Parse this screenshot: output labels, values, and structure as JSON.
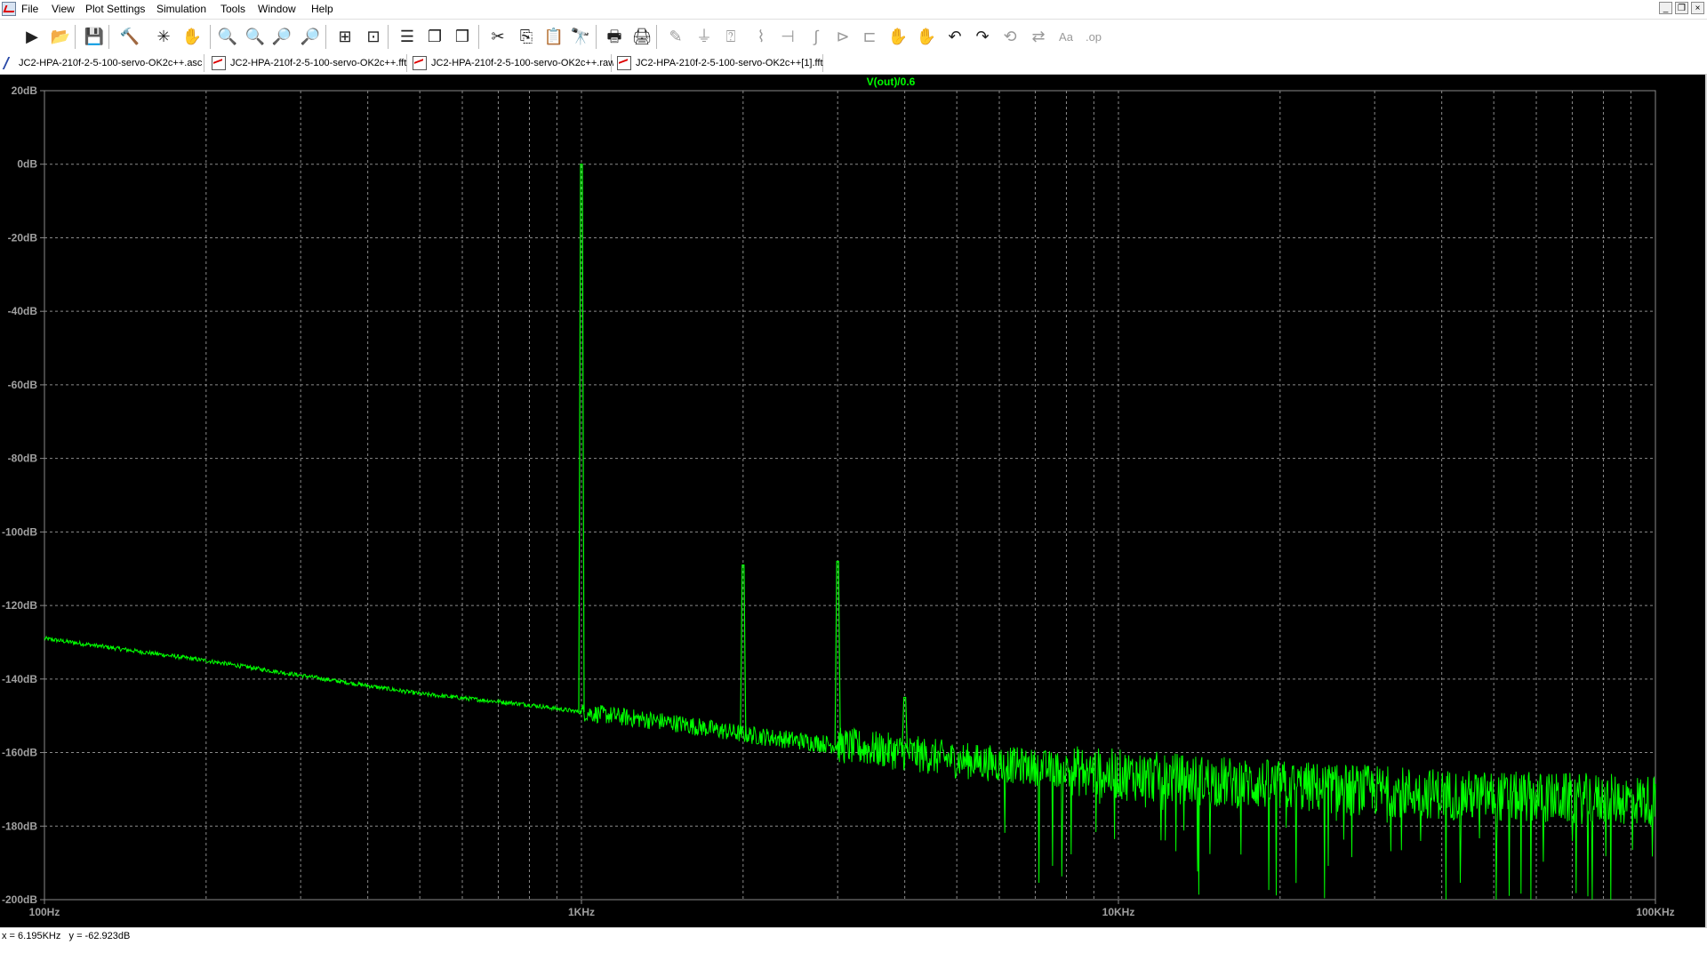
{
  "menu": [
    "File",
    "View",
    "Plot Settings",
    "Simulation",
    "Tools",
    "Window",
    "Help"
  ],
  "window_buttons": [
    "_",
    "❐",
    "×"
  ],
  "toolbar": [
    {
      "name": "run-icon",
      "glyph": "▶"
    },
    {
      "name": "open-folder-icon",
      "glyph": "📂"
    },
    {
      "name": "save-icon",
      "glyph": "💾"
    },
    {
      "name": "control-panel-icon",
      "glyph": "🔨"
    },
    {
      "name": "halt-icon",
      "glyph": "✳"
    },
    {
      "name": "pan-icon",
      "glyph": "✋"
    },
    {
      "name": "zoom-in-icon",
      "glyph": "🔍"
    },
    {
      "name": "zoom-area-icon",
      "glyph": "🔍"
    },
    {
      "name": "zoom-out-icon",
      "glyph": "🔎"
    },
    {
      "name": "zoom-fit-icon",
      "glyph": "🔎"
    },
    {
      "name": "autorange-icon",
      "glyph": "⊞"
    },
    {
      "name": "autoscale-icon",
      "glyph": "⊡"
    },
    {
      "name": "tile-horizontal-icon",
      "glyph": "☰"
    },
    {
      "name": "cascade-icon",
      "glyph": "❐"
    },
    {
      "name": "tile-vertical-icon",
      "glyph": "❒"
    },
    {
      "name": "cut-icon",
      "glyph": "✂"
    },
    {
      "name": "copy-icon",
      "glyph": "⎘"
    },
    {
      "name": "paste-icon",
      "glyph": "📋"
    },
    {
      "name": "find-icon",
      "glyph": "🔭"
    },
    {
      "name": "print-icon",
      "glyph": "🖶"
    },
    {
      "name": "print-setup-icon",
      "glyph": "🖨"
    },
    {
      "name": "wire-icon",
      "glyph": "✎"
    },
    {
      "name": "ground-icon",
      "glyph": "⏚"
    },
    {
      "name": "label-net-icon",
      "glyph": "⍰"
    },
    {
      "name": "resistor-icon",
      "glyph": "⌇"
    },
    {
      "name": "capacitor-icon",
      "glyph": "⊣"
    },
    {
      "name": "inductor-icon",
      "glyph": "∫"
    },
    {
      "name": "diode-icon",
      "glyph": "⊳"
    },
    {
      "name": "component-icon",
      "glyph": "⊏"
    },
    {
      "name": "move-icon",
      "glyph": "✋"
    },
    {
      "name": "drag-icon",
      "glyph": "✋"
    },
    {
      "name": "undo-icon",
      "glyph": "↶"
    },
    {
      "name": "redo-icon",
      "glyph": "↷"
    },
    {
      "name": "rotate-icon",
      "glyph": "⟲"
    },
    {
      "name": "mirror-icon",
      "glyph": "⇄"
    },
    {
      "name": "text-icon",
      "glyph": "Aa"
    },
    {
      "name": "spice-directive-icon",
      "glyph": ".op"
    }
  ],
  "tabs": [
    {
      "label": "JC2-HPA-210f-2-5-100-servo-OK2c++.asc",
      "kind": "sch"
    },
    {
      "label": "JC2-HPA-210f-2-5-100-servo-OK2c++.fft",
      "kind": "fft"
    },
    {
      "label": "JC2-HPA-210f-2-5-100-servo-OK2c++.raw",
      "kind": "fft"
    },
    {
      "label": "JC2-HPA-210f-2-5-100-servo-OK2c++[1].fft",
      "kind": "fft"
    }
  ],
  "status": {
    "cursor": "x = 6.195KHz   y = -62.923dB"
  },
  "chart_data": {
    "type": "line",
    "title": "V(out)/0.6",
    "xscale": "log",
    "xlim": [
      100,
      100000
    ],
    "ylim": [
      -200,
      20
    ],
    "grid": true,
    "x_ticks": [
      {
        "v": 100,
        "label": "100Hz"
      },
      {
        "v": 1000,
        "label": "1KHz"
      },
      {
        "v": 10000,
        "label": "10KHz"
      },
      {
        "v": 100000,
        "label": "100KHz"
      }
    ],
    "y_ticks": [
      {
        "v": 20,
        "label": "20dB"
      },
      {
        "v": 0,
        "label": "0dB"
      },
      {
        "v": -20,
        "label": "-20dB"
      },
      {
        "v": -40,
        "label": "-40dB"
      },
      {
        "v": -60,
        "label": "-60dB"
      },
      {
        "v": -80,
        "label": "-80dB"
      },
      {
        "v": -100,
        "label": "-100dB"
      },
      {
        "v": -120,
        "label": "-120dB"
      },
      {
        "v": -140,
        "label": "-140dB"
      },
      {
        "v": -160,
        "label": "-160dB"
      },
      {
        "v": -180,
        "label": "-180dB"
      },
      {
        "v": -200,
        "label": "-200dB"
      }
    ],
    "colors": {
      "background": "#000000",
      "trace": "#00ff00",
      "grid": "#8a8a8a",
      "axis_text": "#a0a0a0",
      "title": "#00ff00"
    },
    "series": [
      {
        "name": "V(out)/0.6",
        "noise_floor": [
          [
            100,
            -129
          ],
          [
            200,
            -135
          ],
          [
            300,
            -139
          ],
          [
            500,
            -144
          ],
          [
            800,
            -147
          ],
          [
            1000,
            -149
          ],
          [
            1500,
            -152
          ],
          [
            2000,
            -155
          ],
          [
            3000,
            -158
          ],
          [
            4000,
            -160
          ],
          [
            5000,
            -162
          ],
          [
            7000,
            -164
          ],
          [
            10000,
            -166
          ],
          [
            20000,
            -169
          ],
          [
            50000,
            -172
          ],
          [
            100000,
            -173
          ]
        ],
        "peaks": [
          {
            "x": 1000,
            "y": 0
          },
          {
            "x": 2000,
            "y": -109
          },
          {
            "x": 3000,
            "y": -108
          },
          {
            "x": 4000,
            "y": -145
          }
        ]
      }
    ]
  }
}
